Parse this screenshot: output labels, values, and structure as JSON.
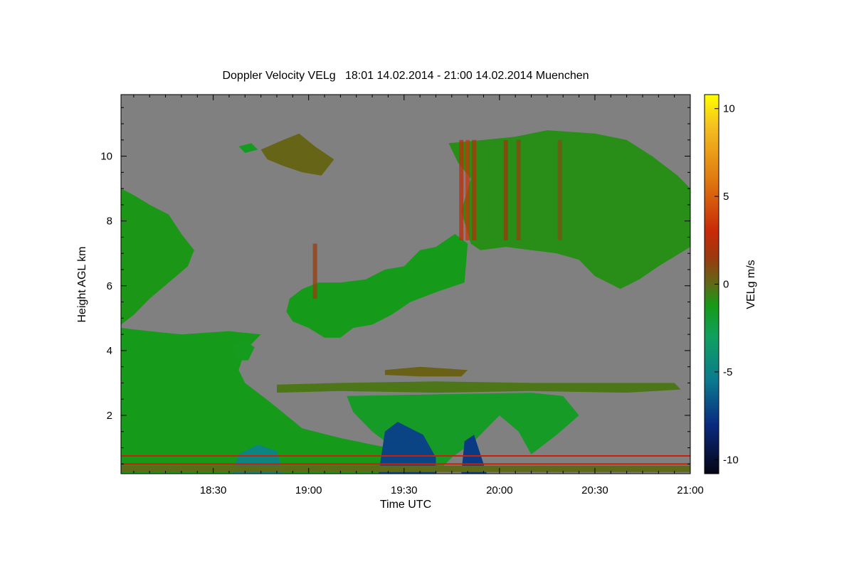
{
  "chart_data": {
    "type": "heatmap",
    "title": "Doppler Velocity VELg   18:01 14.02.2014 - 21:00 14.02.2014 Muenchen",
    "xlabel": "Time UTC",
    "ylabel": "Height AGL km",
    "colorbar_label": "VELg m/s",
    "x_ticks": [
      "18:30",
      "19:00",
      "19:30",
      "20:00",
      "20:30",
      "21:00"
    ],
    "x_tick_minutes": [
      30,
      60,
      90,
      120,
      150,
      180
    ],
    "xlim_minutes": [
      1,
      180
    ],
    "y_ticks": [
      2,
      4,
      6,
      8,
      10
    ],
    "ylim": [
      0.2,
      11.9
    ],
    "colorbar_ticks": [
      10,
      5,
      0,
      -5,
      -10
    ],
    "colorbar_range": [
      -10.8,
      10.8
    ],
    "background_color": "#808080",
    "colormap": [
      {
        "v": -10.8,
        "c": "#050514"
      },
      {
        "v": -8,
        "c": "#0a2a80"
      },
      {
        "v": -5.5,
        "c": "#0b7a8f"
      },
      {
        "v": -3,
        "c": "#10a060"
      },
      {
        "v": -1.2,
        "c": "#169a16"
      },
      {
        "v": 0,
        "c": "#5e6a18"
      },
      {
        "v": 1.5,
        "c": "#9a3a0e"
      },
      {
        "v": 3,
        "c": "#c82a08"
      },
      {
        "v": 6,
        "c": "#e07a10"
      },
      {
        "v": 9,
        "c": "#f5c020"
      },
      {
        "v": 10.8,
        "c": "#ffff00"
      }
    ],
    "echo_regions": [
      {
        "name": "upper-left cloud",
        "velocity": -1.1,
        "outline": [
          [
            1,
            9.0
          ],
          [
            5,
            8.8
          ],
          [
            10,
            8.5
          ],
          [
            16,
            8.2
          ],
          [
            20,
            7.6
          ],
          [
            24,
            7.1
          ],
          [
            22,
            6.6
          ],
          [
            16,
            6.1
          ],
          [
            10,
            5.6
          ],
          [
            5,
            5.1
          ],
          [
            1,
            4.8
          ]
        ]
      },
      {
        "name": "lower-left cloud",
        "velocity": -1.3,
        "outline": [
          [
            1,
            4.7
          ],
          [
            10,
            4.6
          ],
          [
            20,
            4.5
          ],
          [
            35,
            4.6
          ],
          [
            45,
            4.5
          ],
          [
            40,
            4.0
          ],
          [
            38,
            3.4
          ],
          [
            40,
            3.0
          ],
          [
            48,
            2.4
          ],
          [
            58,
            1.6
          ],
          [
            70,
            1.3
          ],
          [
            85,
            1.0
          ],
          [
            95,
            0.5
          ],
          [
            100,
            0.2
          ],
          [
            1,
            0.2
          ]
        ]
      },
      {
        "name": "small cirrus 18:45",
        "velocity": 0.2,
        "outline": [
          [
            45,
            10.2
          ],
          [
            52,
            10.5
          ],
          [
            57,
            10.7
          ],
          [
            62,
            10.3
          ],
          [
            68,
            9.9
          ],
          [
            64,
            9.4
          ],
          [
            58,
            9.5
          ],
          [
            52,
            9.7
          ],
          [
            47,
            9.9
          ]
        ]
      },
      {
        "name": "small cirrus 18:30",
        "velocity": -1.5,
        "outline": [
          [
            38,
            10.3
          ],
          [
            42,
            10.4
          ],
          [
            44,
            10.2
          ],
          [
            40,
            10.1
          ]
        ]
      },
      {
        "name": "mid-level cloud",
        "velocity": -1.3,
        "outline": [
          [
            54,
            5.6
          ],
          [
            58,
            5.9
          ],
          [
            63,
            6.1
          ],
          [
            70,
            6.1
          ],
          [
            78,
            6.2
          ],
          [
            84,
            6.5
          ],
          [
            90,
            6.6
          ],
          [
            95,
            7.1
          ],
          [
            100,
            7.2
          ],
          [
            106,
            7.6
          ],
          [
            110,
            7.3
          ],
          [
            109,
            6.1
          ],
          [
            100,
            5.8
          ],
          [
            92,
            5.5
          ],
          [
            86,
            5.1
          ],
          [
            80,
            4.8
          ],
          [
            74,
            4.7
          ],
          [
            70,
            4.4
          ],
          [
            65,
            4.4
          ],
          [
            60,
            4.7
          ],
          [
            55,
            4.9
          ],
          [
            53,
            5.2
          ]
        ]
      },
      {
        "name": "detached patch",
        "velocity": -1.4,
        "outline": [
          [
            36,
            4.2
          ],
          [
            40,
            4.3
          ],
          [
            43,
            4.1
          ],
          [
            41,
            3.7
          ],
          [
            37,
            3.7
          ]
        ]
      },
      {
        "name": "upper-right cloud",
        "velocity": -0.9,
        "outline": [
          [
            104,
            10.4
          ],
          [
            115,
            10.5
          ],
          [
            125,
            10.6
          ],
          [
            135,
            10.8
          ],
          [
            150,
            10.7
          ],
          [
            160,
            10.5
          ],
          [
            168,
            10.0
          ],
          [
            176,
            9.4
          ],
          [
            180,
            9.0
          ],
          [
            180,
            7.2
          ],
          [
            175,
            6.9
          ],
          [
            170,
            6.6
          ],
          [
            164,
            6.2
          ],
          [
            158,
            5.9
          ],
          [
            150,
            6.3
          ],
          [
            145,
            6.8
          ],
          [
            138,
            7.0
          ],
          [
            130,
            7.1
          ],
          [
            122,
            7.2
          ],
          [
            114,
            7.1
          ],
          [
            111,
            7.3
          ],
          [
            108,
            8.3
          ],
          [
            111,
            9.3
          ],
          [
            107,
            9.8
          ]
        ]
      },
      {
        "name": "band 2.9 km",
        "velocity": -0.3,
        "outline": [
          [
            50,
            2.95
          ],
          [
            70,
            3.0
          ],
          [
            100,
            3.05
          ],
          [
            130,
            3.0
          ],
          [
            160,
            3.0
          ],
          [
            175,
            3.0
          ],
          [
            177,
            2.8
          ],
          [
            160,
            2.7
          ],
          [
            130,
            2.75
          ],
          [
            100,
            2.7
          ],
          [
            70,
            2.75
          ],
          [
            50,
            2.7
          ]
        ]
      },
      {
        "name": "band 3.4 km",
        "velocity": 0.3,
        "outline": [
          [
            84,
            3.4
          ],
          [
            95,
            3.5
          ],
          [
            110,
            3.4
          ],
          [
            108,
            3.2
          ],
          [
            95,
            3.2
          ],
          [
            84,
            3.25
          ]
        ]
      },
      {
        "name": "fall streaks",
        "velocity": -1.6,
        "outline": [
          [
            72,
            2.6
          ],
          [
            130,
            2.7
          ],
          [
            140,
            2.6
          ],
          [
            145,
            2.0
          ],
          [
            138,
            1.4
          ],
          [
            130,
            0.8
          ],
          [
            126,
            1.5
          ],
          [
            120,
            2.0
          ],
          [
            112,
            1.2
          ],
          [
            105,
            0.7
          ],
          [
            100,
            0.2
          ],
          [
            94,
            0.2
          ],
          [
            88,
            0.9
          ],
          [
            80,
            1.5
          ],
          [
            74,
            2.1
          ]
        ]
      },
      {
        "name": "convective cell 18:45",
        "velocity": -4.8,
        "outline": [
          [
            36,
            0.2
          ],
          [
            38,
            0.8
          ],
          [
            44,
            1.1
          ],
          [
            50,
            0.9
          ],
          [
            52,
            0.2
          ]
        ]
      },
      {
        "name": "convective cell 19:30",
        "velocity": -7.2,
        "outline": [
          [
            82,
            0.2
          ],
          [
            84,
            1.5
          ],
          [
            88,
            1.8
          ],
          [
            92,
            1.6
          ],
          [
            96,
            1.4
          ],
          [
            100,
            0.7
          ],
          [
            100,
            0.2
          ]
        ]
      },
      {
        "name": "convective cell 19:55",
        "velocity": -7.5,
        "outline": [
          [
            108,
            0.2
          ],
          [
            109,
            1.2
          ],
          [
            112,
            1.4
          ],
          [
            116,
            0.2
          ]
        ]
      },
      {
        "name": "clutter 0.35 km",
        "velocity": 0.0,
        "outline": [
          [
            1,
            0.25
          ],
          [
            180,
            0.25
          ],
          [
            180,
            0.45
          ],
          [
            1,
            0.45
          ]
        ]
      }
    ],
    "velocity_streaks": [
      {
        "minute": 108,
        "velocity": 2.6
      },
      {
        "minute": 110,
        "velocity": 3.4
      },
      {
        "minute": 112,
        "velocity": 2.2
      },
      {
        "minute": 122,
        "velocity": 1.5
      },
      {
        "minute": 126,
        "velocity": 1.2
      },
      {
        "minute": 139,
        "velocity": 0.8
      },
      {
        "minute": 62,
        "velocity": 1.4
      }
    ],
    "clutter_lines_km": [
      0.5,
      0.75
    ]
  }
}
